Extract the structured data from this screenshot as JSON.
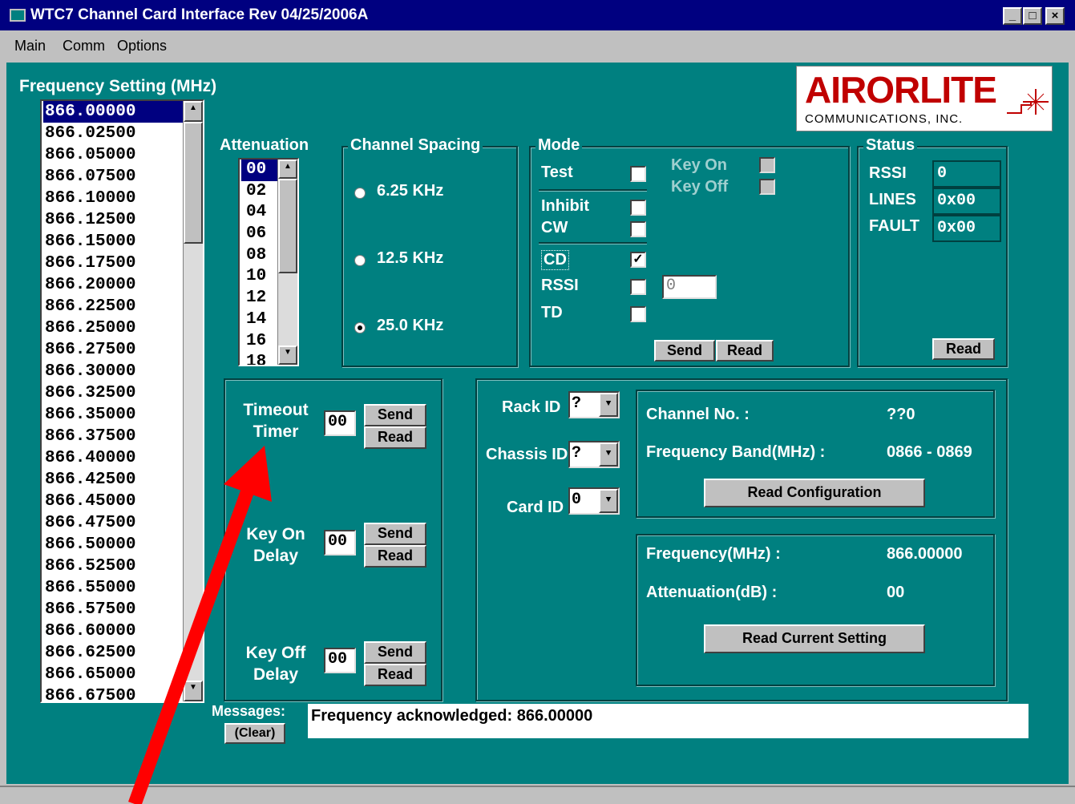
{
  "window": {
    "title": "WTC7 Channel Card Interface Rev 04/25/2006A",
    "min_label": "_",
    "max_label": "□",
    "close_label": "×"
  },
  "menu": [
    {
      "label": "Main"
    },
    {
      "label": "Comm"
    },
    {
      "label": "Options"
    }
  ],
  "frequency": {
    "heading": "Frequency Setting (MHz)",
    "items": [
      "866.00000",
      "866.02500",
      "866.05000",
      "866.07500",
      "866.10000",
      "866.12500",
      "866.15000",
      "866.17500",
      "866.20000",
      "866.22500",
      "866.25000",
      "866.27500",
      "866.30000",
      "866.32500",
      "866.35000",
      "866.37500",
      "866.40000",
      "866.42500",
      "866.45000",
      "866.47500",
      "866.50000",
      "866.52500",
      "866.55000",
      "866.57500",
      "866.60000",
      "866.62500",
      "866.65000",
      "866.67500"
    ],
    "selected": "866.00000"
  },
  "attenuation": {
    "label": "Attenuation",
    "items": [
      "00",
      "02",
      "04",
      "06",
      "08",
      "10",
      "12",
      "14",
      "16",
      "18"
    ],
    "selected": "00"
  },
  "channel_spacing": {
    "title": "Channel Spacing",
    "options": [
      "6.25 KHz",
      "12.5 KHz",
      "25.0 KHz"
    ],
    "selected": "25.0 KHz"
  },
  "mode": {
    "title": "Mode",
    "test": {
      "label": "Test",
      "checked": false
    },
    "inhibit": {
      "label": "Inhibit",
      "checked": false
    },
    "cw": {
      "label": "CW",
      "checked": false
    },
    "cd": {
      "label": "CD",
      "checked": true,
      "mark": "✓"
    },
    "rssi": {
      "label": "RSSI",
      "checked": false,
      "value": "0"
    },
    "td": {
      "label": "TD",
      "checked": false
    },
    "key_on": {
      "label": "Key On"
    },
    "key_off": {
      "label": "Key Off"
    },
    "send_label": "Send",
    "read_label": "Read"
  },
  "status": {
    "title": "Status",
    "rssi_label": "RSSI",
    "rssi_value": "0",
    "lines_label": "LINES",
    "lines_value": "0x00",
    "fault_label": "FAULT",
    "fault_value": "0x00",
    "read_label": "Read"
  },
  "timers": {
    "timeout": {
      "line1": "Timeout",
      "line2": "Timer",
      "value": "00"
    },
    "key_on_delay": {
      "line1": "Key On",
      "line2": "Delay",
      "value": "00"
    },
    "key_off_delay": {
      "line1": "Key Off",
      "line2": "Delay",
      "value": "00"
    },
    "send_label": "Send",
    "read_label": "Read"
  },
  "ids": {
    "rack": {
      "label": "Rack ID",
      "value": "?"
    },
    "chassis": {
      "label": "Chassis ID",
      "value": "?"
    },
    "card": {
      "label": "Card ID",
      "value": "0"
    }
  },
  "config": {
    "channel_label": "Channel No. :",
    "channel_value": "??0",
    "band_label": "Frequency Band(MHz) :",
    "band_value": "0866 - 0869",
    "read_config_label": "Read Configuration"
  },
  "current": {
    "freq_label": "Frequency(MHz) :",
    "freq_value": "866.00000",
    "atten_label": "Attenuation(dB) :",
    "atten_value": "00",
    "read_current_label": "Read Current Setting"
  },
  "messages": {
    "label": "Messages:",
    "clear_label": "(Clear)",
    "text": "Frequency acknowledged: 866.00000"
  },
  "logo": {
    "main": "AIRORLITE",
    "sub": "COMMUNICATIONS, INC."
  },
  "annotation": {
    "color": "#ff0000",
    "points_to": "timeout-timer"
  },
  "colors": {
    "client": "#008080",
    "titlebar": "#000080",
    "chrome": "#c0c0c0"
  }
}
